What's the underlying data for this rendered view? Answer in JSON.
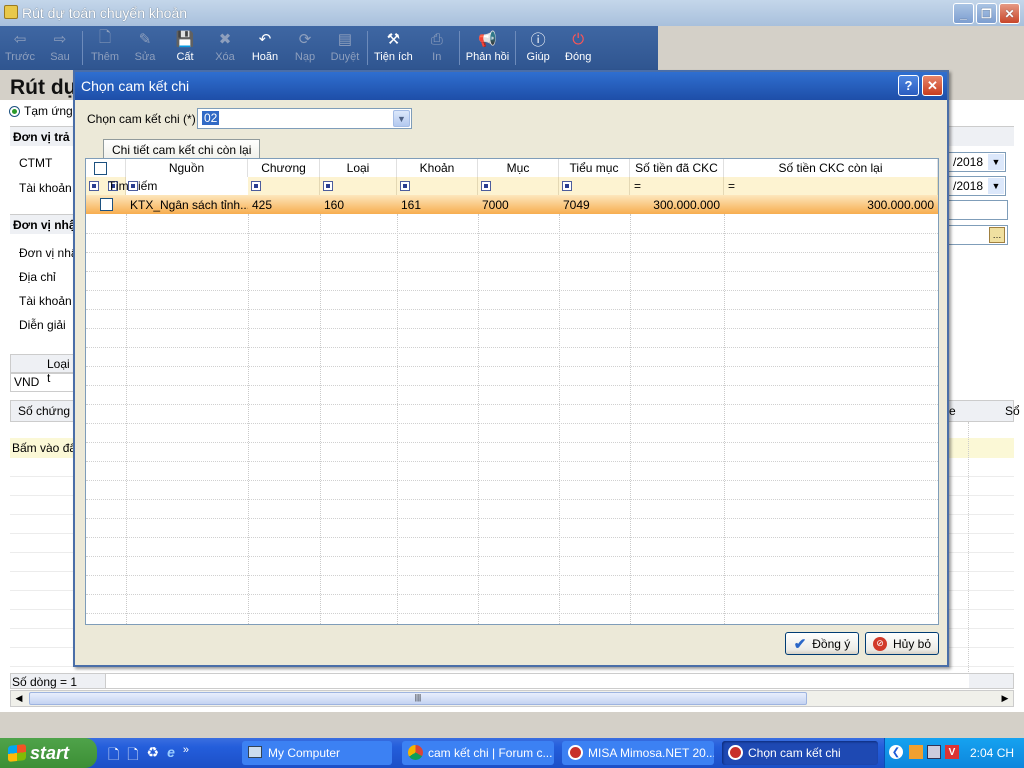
{
  "window": {
    "title": "Rút dự toán chuyển khoản"
  },
  "toolbar": {
    "items": [
      {
        "label": "Trước",
        "icon": "arrow-left-icon",
        "enabled": false
      },
      {
        "label": "Sau",
        "icon": "arrow-right-icon",
        "enabled": false
      },
      {
        "label": "Thêm",
        "icon": "new-doc-icon",
        "enabled": false
      },
      {
        "label": "Sửa",
        "icon": "edit-icon",
        "enabled": false
      },
      {
        "label": "Cất",
        "icon": "save-icon",
        "enabled": true
      },
      {
        "label": "Xóa",
        "icon": "delete-icon",
        "enabled": false
      },
      {
        "label": "Hoãn",
        "icon": "undo-icon",
        "enabled": true
      },
      {
        "label": "Nạp",
        "icon": "reload-icon",
        "enabled": false
      },
      {
        "label": "Duyệt",
        "icon": "approve-icon",
        "enabled": false
      },
      {
        "label": "Tiện ích",
        "icon": "tools-icon",
        "enabled": true
      },
      {
        "label": "In",
        "icon": "print-icon",
        "enabled": false
      },
      {
        "label": "Phản hồi",
        "icon": "megaphone-icon",
        "enabled": true
      },
      {
        "label": "Giúp",
        "icon": "help-icon",
        "enabled": true
      },
      {
        "label": "Đóng",
        "icon": "power-icon",
        "enabled": true
      }
    ]
  },
  "main": {
    "heading": "Rút dự",
    "radio_label": "Tạm ứng d",
    "section_payer": "Đơn vị trả ti",
    "ctmt_label": "CTMT",
    "account_label": "Tài khoản t",
    "date1": "/2018",
    "date2": "/2018",
    "section_receiver": "Đơn vị nhận",
    "receiver_unit_label": "Đơn vị nhậ",
    "address_label": "Địa chỉ",
    "receiver_account_label": "Tài khoản n",
    "description_label": "Diễn giải",
    "currency_type_label": "Loại t",
    "currency_value": "VND",
    "voucher_no_label": "Số chứng từ",
    "right_col_header": "Sổ",
    "click_here_text": "Bấm vào đây",
    "row_count_text": "Số dòng = 1"
  },
  "dialog": {
    "title": "Chọn cam kết chi",
    "select_label": "Chọn cam kết chi (*)",
    "select_value": "02",
    "tab_label": "Chi tiết cam kết chi còn lại",
    "columns": [
      "Nguồn",
      "Chương",
      "Loại",
      "Khoản",
      "Mục",
      "Tiểu mục",
      "Số tiền đã CKC",
      "Số tiền CKC còn lại"
    ],
    "filter_label": "Tìm kiếm",
    "filter_eq": "=",
    "rows": [
      {
        "nguon": "KTX_Ngân sách tỉnh...",
        "chuong": "425",
        "loai": "160",
        "khoan": "161",
        "muc": "7000",
        "tieu_muc": "7049",
        "da_ckc": "300.000.000",
        "con_lai": "300.000.000"
      }
    ],
    "ok_label": "Đồng ý",
    "cancel_label": "Hủy bỏ"
  },
  "taskbar": {
    "start_label": "start",
    "tasks": [
      {
        "label": "My Computer",
        "icon": "computer-icon"
      },
      {
        "label": "cam kết chi | Forum c...",
        "icon": "chrome-icon"
      },
      {
        "label": "MISA Mimosa.NET 20...",
        "icon": "misa-icon"
      },
      {
        "label": "Chọn cam kết chi",
        "icon": "misa-icon"
      }
    ],
    "clock": "2:04 CH"
  }
}
